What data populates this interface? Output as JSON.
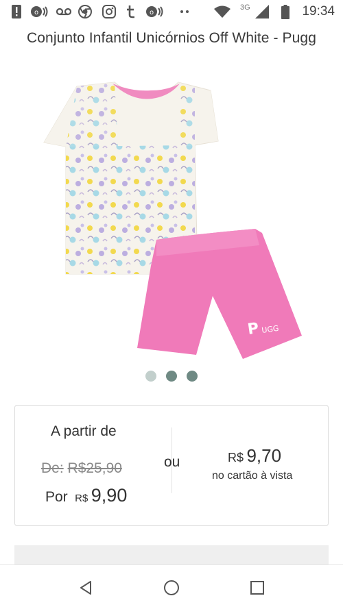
{
  "status_bar": {
    "time": "19:34",
    "network_type": "3G",
    "icons": [
      "alert-icon",
      "radio-icon",
      "voicemail-icon",
      "chrome-icon",
      "instagram-icon",
      "tumblr-icon",
      "radio-icon",
      "more-dots-icon",
      "wifi-icon",
      "signal-icon",
      "battery-icon"
    ]
  },
  "page": {
    "title": "Conjunto Infantil Unicórnios Off White - Pugg"
  },
  "product_image": {
    "description_icon": "product-photo",
    "shorts_logo": "PUGG",
    "carousel": {
      "count": 3,
      "active": 1
    }
  },
  "price": {
    "from_label": "A partir de",
    "old_label": "De:",
    "old_value": "R$25,90",
    "por_label": "Por",
    "currency": "R$",
    "por_value": "9,90",
    "or_label": "ou",
    "card_currency": "R$",
    "card_value": "9,70",
    "card_note": "no cartão à vista"
  },
  "colors": {
    "accent_pink": "#f07ab9",
    "shirt": "#f6f3ec",
    "dot_inactive": "#6f8a84",
    "dot_active": "#c2cfcc"
  },
  "nav": {
    "icons": [
      "back-icon",
      "home-icon",
      "recents-icon"
    ]
  }
}
